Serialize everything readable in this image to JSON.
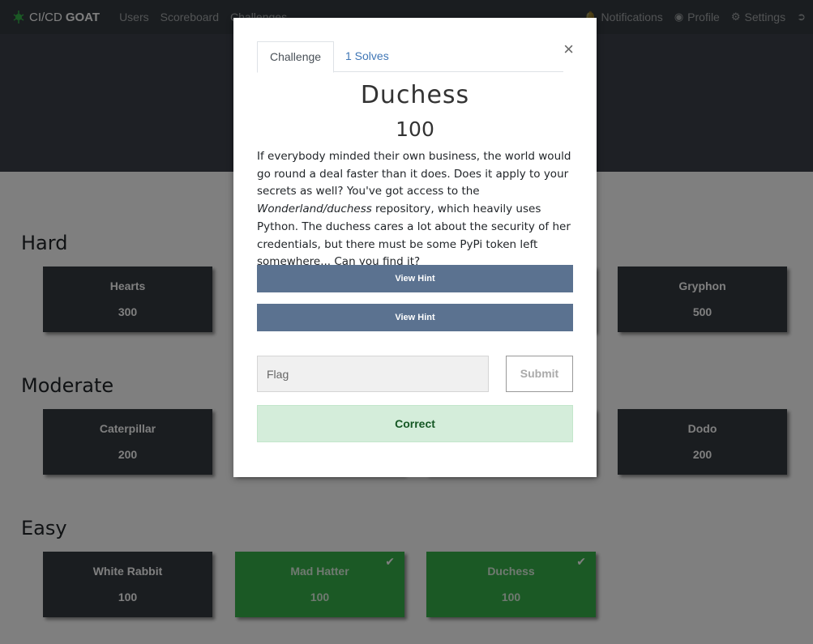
{
  "navbar": {
    "brand_prefix": "CI/CD",
    "brand_name": "GOAT",
    "links": [
      "Users",
      "Scoreboard",
      "Challenges"
    ],
    "right": [
      {
        "label": "Notifications",
        "icon": "bell-icon"
      },
      {
        "label": "Profile",
        "icon": "user-circle-icon"
      },
      {
        "label": "Settings",
        "icon": "gears-icon"
      },
      {
        "label": "",
        "icon": "logout-icon"
      }
    ]
  },
  "board": {
    "categories": [
      {
        "title": "Hard",
        "cards": [
          {
            "name": "Hearts",
            "value": "300",
            "solved": false
          },
          {
            "name": "",
            "value": "",
            "solved": false
          },
          {
            "name": "",
            "value": "",
            "solved": false
          },
          {
            "name": "Gryphon",
            "value": "500",
            "solved": false
          }
        ]
      },
      {
        "title": "Moderate",
        "cards": [
          {
            "name": "Caterpillar",
            "value": "200",
            "solved": false
          },
          {
            "name": "",
            "value": "",
            "solved": false
          },
          {
            "name": "",
            "value": "",
            "solved": false
          },
          {
            "name": "Dodo",
            "value": "200",
            "solved": false
          }
        ]
      },
      {
        "title": "Easy",
        "cards": [
          {
            "name": "White Rabbit",
            "value": "100",
            "solved": false
          },
          {
            "name": "Mad Hatter",
            "value": "100",
            "solved": true
          },
          {
            "name": "Duchess",
            "value": "100",
            "solved": true
          }
        ]
      }
    ]
  },
  "modal": {
    "tabs": [
      "Challenge",
      "1 Solves"
    ],
    "close": "×",
    "title": "Duchess",
    "value": "100",
    "description_parts": [
      "If everybody minded their own business, the world would go round a deal faster than it does. Does it apply to your secrets as well? You've got access to the ",
      "Wonderland/duchess",
      " repository, which heavily uses Python. The duchess cares a lot about the security of her credentials, but there must be some PyPi token left somewhere... Can you find it?"
    ],
    "hints": [
      "View Hint",
      "View Hint"
    ],
    "flag_placeholder": "Flag",
    "submit_label": "Submit",
    "result_text": "Correct"
  },
  "colors": {
    "navbar": "#343a40",
    "card": "#343a40",
    "solved_card": "#37b34a",
    "hint_button": "#5b7290",
    "correct_bg": "#d4edda",
    "link": "#3f76b5"
  }
}
